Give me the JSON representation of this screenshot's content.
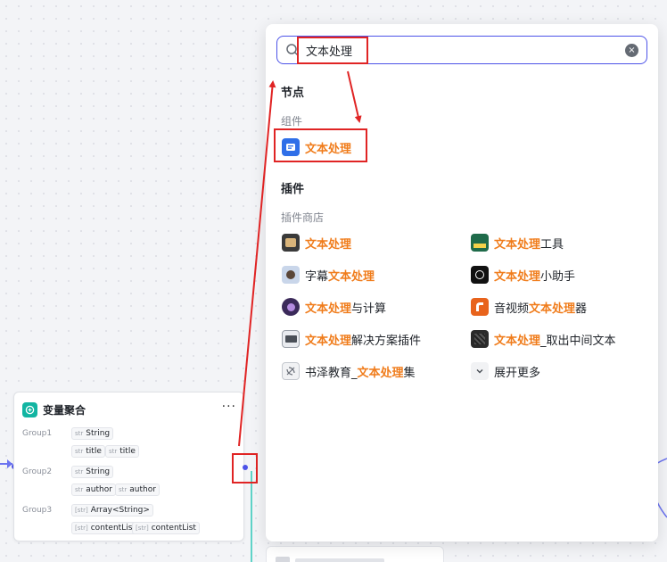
{
  "node": {
    "title": "变量聚合",
    "more": "···",
    "groups": [
      {
        "label": "Group1",
        "type": "String",
        "values": [
          "title",
          "title"
        ]
      },
      {
        "label": "Group2",
        "type": "String",
        "values": [
          "author",
          "author"
        ]
      },
      {
        "label": "Group3",
        "type": "Array<String>",
        "values": [
          "contentList",
          "contentList"
        ]
      }
    ],
    "str_prefix": "str",
    "arr_prefix": "[str]"
  },
  "panel": {
    "search": {
      "value": "文本处理",
      "placeholder": ""
    },
    "nodes_title": "节点",
    "components_title": "组件",
    "component_item": {
      "highlight": "文本处理",
      "suffix": ""
    },
    "plugins_title": "插件",
    "store_title": "插件商店",
    "plugins": [
      {
        "prefix": "",
        "highlight": "文本处理",
        "suffix": ""
      },
      {
        "prefix": "",
        "highlight": "文本处理",
        "suffix": "工具"
      },
      {
        "prefix": "字幕",
        "highlight": "文本处理",
        "suffix": ""
      },
      {
        "prefix": "",
        "highlight": "文本处理",
        "suffix": "小助手"
      },
      {
        "prefix": "",
        "highlight": "文本处理",
        "suffix": "与计算"
      },
      {
        "prefix": "音视频",
        "highlight": "文本处理",
        "suffix": "器"
      },
      {
        "prefix": "",
        "highlight": "文本处理",
        "suffix": "解决方案插件"
      },
      {
        "prefix": "",
        "highlight": "文本处理",
        "suffix": "_取出中间文本"
      },
      {
        "prefix": "书泽教育_",
        "highlight": "文本处理",
        "suffix": "集"
      }
    ],
    "expand_more": "展开更多"
  },
  "colors": {
    "accent": "#4d53e8",
    "highlight": "#f07c1b",
    "annotation": "#e02424",
    "node_icon": "#12b5a2"
  }
}
